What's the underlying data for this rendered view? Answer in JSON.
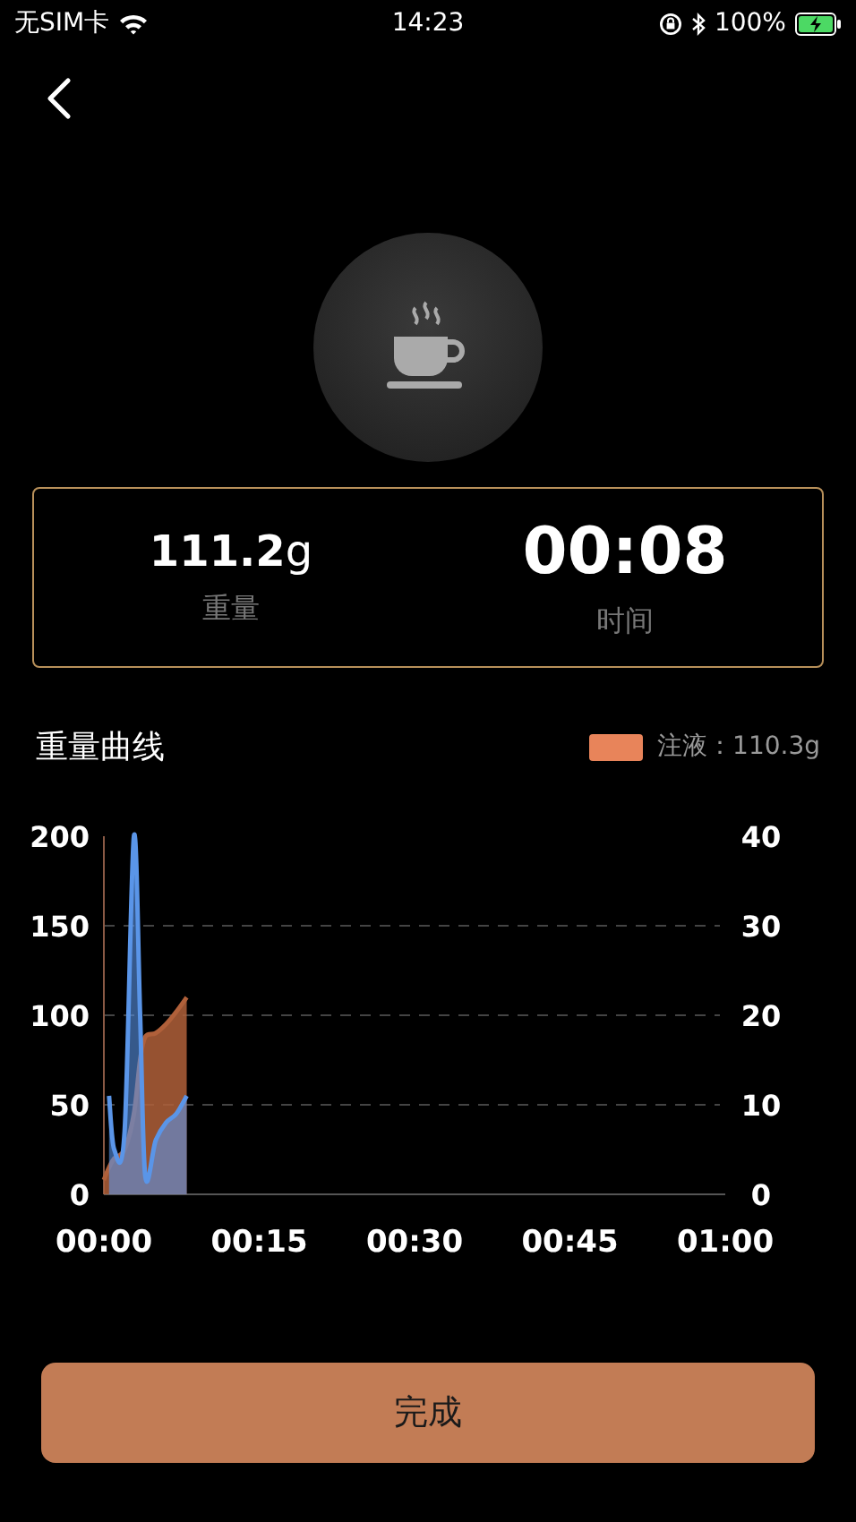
{
  "status_bar": {
    "carrier": "无SIM卡",
    "time": "14:23",
    "battery": "100%"
  },
  "stats": [
    {
      "value": "**111.2**g",
      "label": "重量",
      "kind": "weight"
    },
    {
      "value": "00:08",
      "label": "时间",
      "kind": "time"
    }
  ],
  "chart": {
    "title": "重量曲线",
    "legend": {
      "label": "注液：110.3g",
      "color": "#e8845a"
    },
    "chart_data": {
      "type": "area",
      "x": [
        0,
        0.5,
        1,
        2,
        2.9,
        3.5,
        4,
        5,
        6,
        7,
        8
      ],
      "xlim": [
        0,
        60
      ],
      "ylim": [
        0,
        200
      ],
      "xticks": [
        {
          "value": 0,
          "label": "00:00"
        },
        {
          "value": 15,
          "label": "00:15"
        },
        {
          "value": 30,
          "label": "00:30"
        },
        {
          "value": 45,
          "label": "00:45"
        },
        {
          "value": 60,
          "label": "01:00"
        }
      ],
      "yticks": [
        0,
        50,
        100,
        150,
        200
      ],
      "y2lim": [
        0,
        40
      ],
      "y2ticks": [
        0,
        10,
        20,
        30,
        40
      ],
      "grid": true,
      "series": [
        {
          "color": "#b0603a",
          "values": [
            8,
            15,
            20,
            25,
            45,
            75,
            88,
            90,
            95,
            102,
            110
          ]
        },
        {
          "color": "#5a95e8",
          "axis": "y2",
          "values": [
            null,
            11,
            5,
            7,
            40,
            20,
            2,
            6,
            8,
            9,
            11
          ]
        }
      ]
    }
  },
  "button": {
    "label": "完成"
  }
}
